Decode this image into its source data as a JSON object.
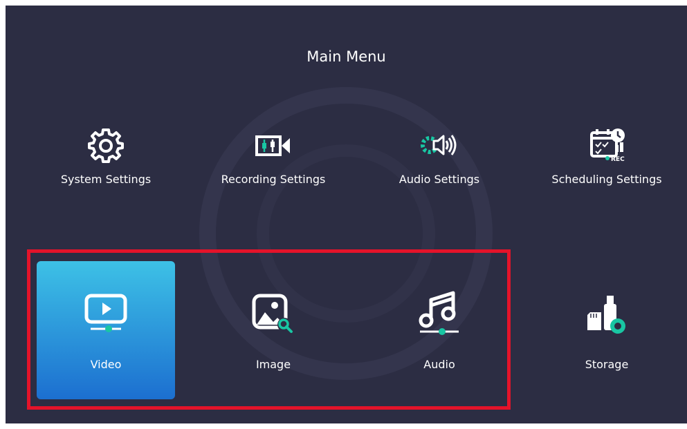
{
  "title": "Main Menu",
  "menu": {
    "row1": [
      {
        "label": "System Settings",
        "icon": "gear-icon"
      },
      {
        "label": "Recording Settings",
        "icon": "video-recording-icon"
      },
      {
        "label": "Audio Settings",
        "icon": "audio-settings-icon"
      },
      {
        "label": "Scheduling Settings",
        "icon": "schedule-rec-icon"
      }
    ],
    "row2": [
      {
        "label": "Video",
        "icon": "video-player-icon",
        "selected": true
      },
      {
        "label": "Image",
        "icon": "image-search-icon"
      },
      {
        "label": "Audio",
        "icon": "music-note-icon"
      },
      {
        "label": "Storage",
        "icon": "storage-icon"
      }
    ],
    "schedule_badge": "REC"
  },
  "colors": {
    "background": "#2c2d43",
    "accent_icon": "#19c6a3",
    "selected_top": "#3dc1e6",
    "selected_bottom": "#1c6fd0",
    "highlight_border": "#e4132a"
  }
}
